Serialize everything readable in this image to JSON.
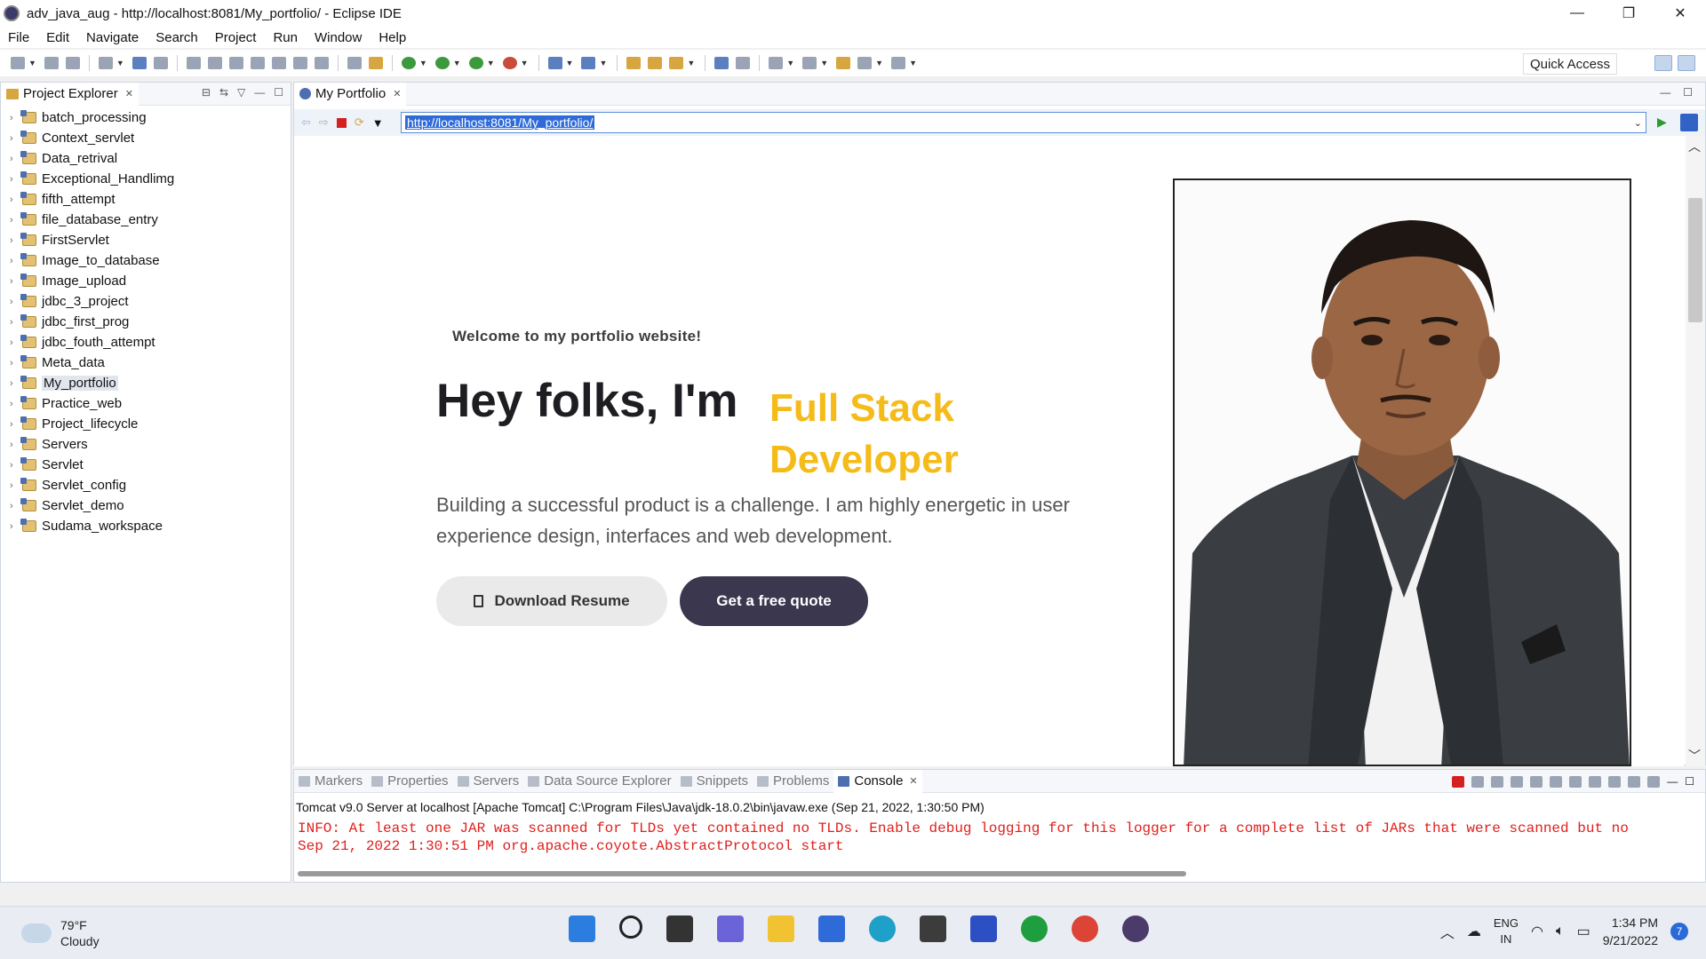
{
  "window": {
    "title": "adv_java_aug - http://localhost:8081/My_portfolio/ - Eclipse IDE",
    "controls": [
      "—",
      "❐",
      "✕"
    ]
  },
  "menu": [
    "File",
    "Edit",
    "Navigate",
    "Search",
    "Project",
    "Run",
    "Window",
    "Help"
  ],
  "toolbar": {
    "quick_access": "Quick Access"
  },
  "explorer": {
    "tab_label": "Project Explorer",
    "projects": [
      "batch_processing",
      "Context_servlet",
      "Data_retrival",
      "Exceptional_Handlimg",
      "fifth_attempt",
      "file_database_entry",
      "FirstServlet",
      "Image_to_database",
      "Image_upload",
      "jdbc_3_project",
      "jdbc_first_prog",
      "jdbc_fouth_attempt",
      "Meta_data",
      "My_portfolio",
      "Practice_web",
      "Project_lifecycle",
      "Servers",
      "Servlet",
      "Servlet_config",
      "Servlet_demo",
      "Sudama_workspace"
    ],
    "selected": "My_portfolio"
  },
  "editor": {
    "tab_label": "My Portfolio",
    "url": "http://localhost:8081/My_portfolio/"
  },
  "portfolio": {
    "welcome": "Welcome to my portfolio website!",
    "hero_prefix": "Hey folks, I'm",
    "hero_role_line1": "Full Stack",
    "hero_role_line2": "Developer",
    "description": "Building a successful product is a challenge. I am highly energetic in user experience design, interfaces and web development.",
    "btn_resume": "Download Resume",
    "btn_quote": "Get a free quote",
    "accent_color": "#f5bb19",
    "quote_btn_color": "#3a374f"
  },
  "console": {
    "tabs": [
      "Markers",
      "Properties",
      "Servers",
      "Data Source Explorer",
      "Snippets",
      "Problems",
      "Console"
    ],
    "active_tab": "Console",
    "header": "Tomcat v9.0 Server at localhost [Apache Tomcat] C:\\Program Files\\Java\\jdk-18.0.2\\bin\\javaw.exe (Sep 21, 2022, 1:30:50 PM)",
    "log_line1": "INFO: At least one JAR was scanned for TLDs yet contained no TLDs. Enable debug logging for this logger for a complete list of JARs that were scanned but no",
    "log_line2": "Sep 21, 2022 1:30:51 PM org.apache.coyote.AbstractProtocol start",
    "log_color": "#e0201c"
  },
  "taskbar": {
    "temperature": "79°F",
    "condition": "Cloudy",
    "lang_line1": "ENG",
    "lang_line2": "IN",
    "time": "1:34 PM",
    "date": "9/21/2022",
    "notification_count": "7"
  }
}
